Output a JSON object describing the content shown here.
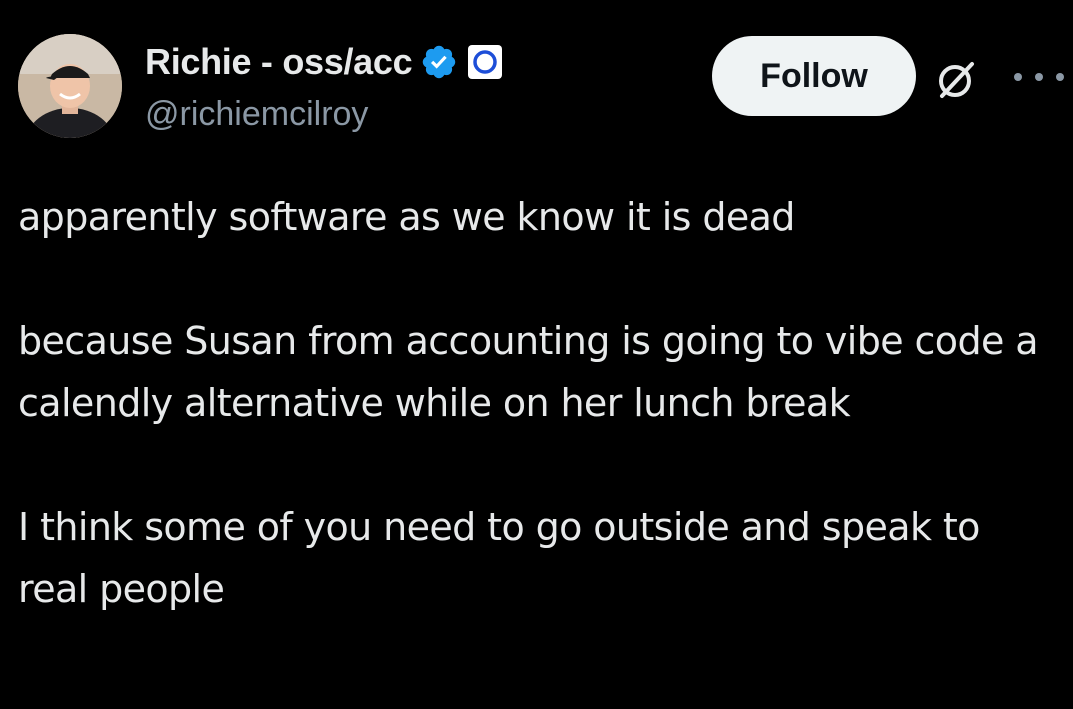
{
  "author": {
    "display_name": "Richie - oss/acc",
    "handle": "@richiemcilroy",
    "verified": true
  },
  "actions": {
    "follow_label": "Follow"
  },
  "icons": {
    "verified": "verified-badge-icon",
    "affiliate": "affiliate-badge-icon",
    "grok": "grok-icon",
    "more": "more-icon"
  },
  "colors": {
    "background": "#000000",
    "text": "#e7e9ea",
    "secondary_text": "#8b98a5",
    "verified_blue": "#1d9bf0",
    "follow_button_bg": "#eff3f4"
  },
  "tweet": {
    "paragraphs": [
      "apparently software as we know it is dead",
      "because Susan from accounting is going to vibe code a calendly alternative while on her lunch break",
      "I think some of you need to go outside and speak to real people"
    ]
  }
}
